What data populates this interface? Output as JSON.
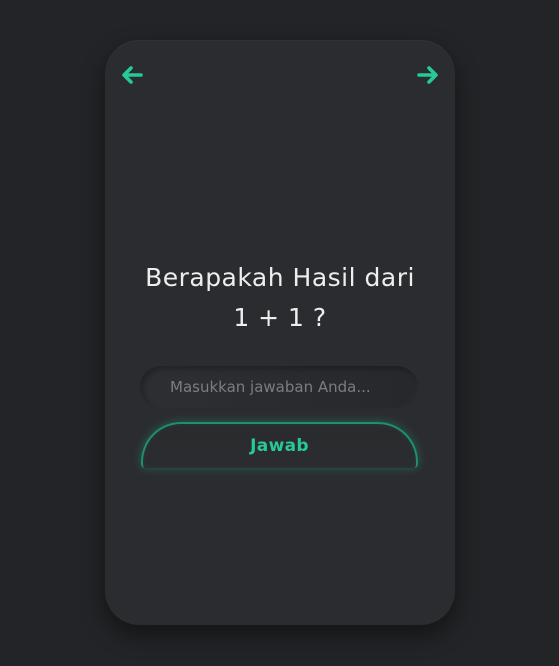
{
  "colors": {
    "background": "#232427",
    "card": "#2b2c2f",
    "accent": "#25c99a",
    "question_text": "#eeeeee",
    "placeholder_text": "#7c7d80"
  },
  "nav": {
    "prev_icon": "arrow-left-icon",
    "next_icon": "arrow-right-icon"
  },
  "quiz": {
    "question_line1": "Berapakah Hasil dari",
    "question_line2": "1 + 1 ?"
  },
  "answer": {
    "placeholder": "Masukkan jawaban Anda...",
    "value": ""
  },
  "submit": {
    "label": "Jawab"
  }
}
